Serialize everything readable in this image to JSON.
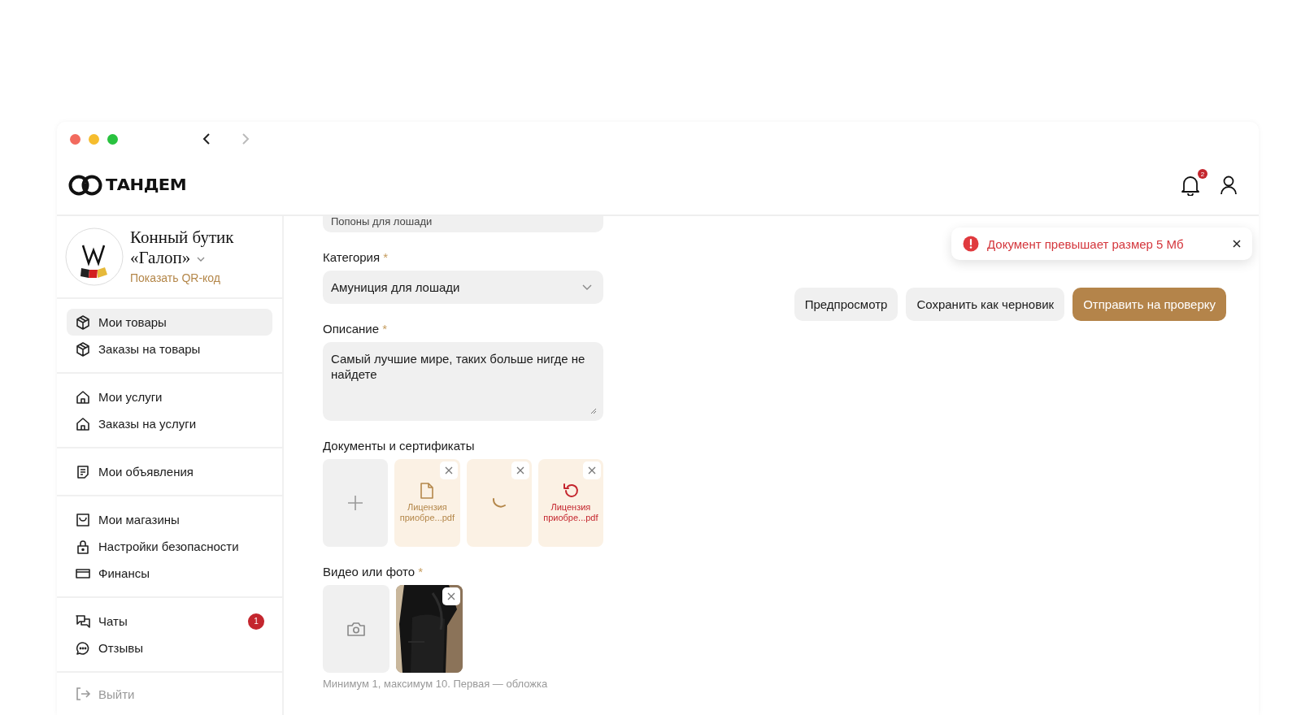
{
  "navigation": {
    "back_disabled": false,
    "forward_disabled": true
  },
  "header": {
    "logo": "ТАНДЕМ",
    "notifications": "2"
  },
  "shop": {
    "name": "Конный бутик «Галоп»",
    "qr_link": "Показать QR-код"
  },
  "sidebar": {
    "groups": [
      {
        "items": [
          {
            "label": "Мои товары",
            "selected": true
          },
          {
            "label": "Заказы на товары",
            "selected": false
          }
        ]
      },
      {
        "items": [
          {
            "label": "Мои услуги",
            "selected": false
          },
          {
            "label": "Заказы на услуги",
            "selected": false
          }
        ]
      },
      {
        "items": [
          {
            "label": "Мои объявления",
            "selected": false
          }
        ]
      },
      {
        "items": [
          {
            "label": "Мои магазины",
            "selected": false
          },
          {
            "label": "Настройки безопасности",
            "selected": false
          },
          {
            "label": "Финансы",
            "selected": false
          }
        ]
      },
      {
        "items": [
          {
            "label": "Чаты",
            "selected": false,
            "badge": "1"
          },
          {
            "label": "Отзывы",
            "selected": false
          }
        ]
      }
    ],
    "logout": "Выйти"
  },
  "form": {
    "cut_field": "Попоны для лошади",
    "category": {
      "label": "Категория",
      "required_mark": "*",
      "value": "Амуниция для лошади"
    },
    "description": {
      "label": "Описание",
      "required_mark": "*",
      "value": "Самый лучшие мире, таких больше нигде не найдете"
    },
    "documents": {
      "label": "Документы и сертификаты",
      "files": [
        {
          "kind": "done",
          "name": "Лицензия приобре...pdf"
        },
        {
          "kind": "loading"
        },
        {
          "kind": "error",
          "name": "Лицензия приобре...pdf"
        }
      ]
    },
    "media": {
      "label": "Видео или фото",
      "required_mark": "*",
      "hint": "Минимум 1, максимум 10. Первая — обложка"
    }
  },
  "actions": [
    {
      "label": "Предпросмотр",
      "primary": false
    },
    {
      "label": "Сохранить как черновик",
      "primary": false
    },
    {
      "label": "Отправить на проверку",
      "primary": true
    }
  ],
  "toast": {
    "kind": "error",
    "message": "Документ превышает размер 5 Мб"
  }
}
